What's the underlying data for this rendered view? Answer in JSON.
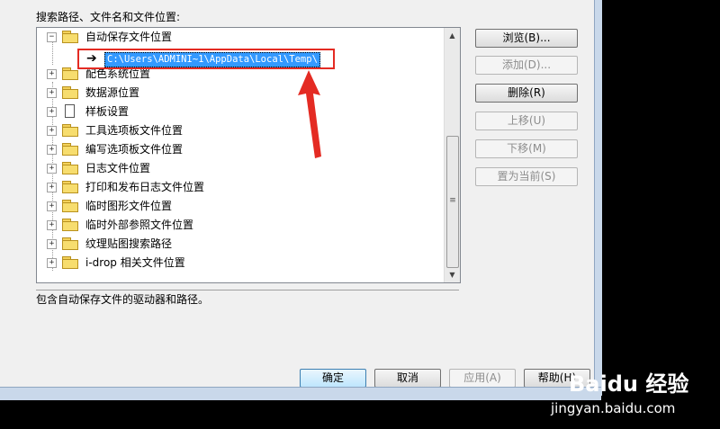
{
  "dialog": {
    "caption": "搜索路径、文件名和文件位置:",
    "tree": {
      "items": [
        {
          "label": "自动保存文件位置",
          "expander": "⊟",
          "icon": "folder-icon",
          "expanded": true
        },
        {
          "label": "配色系统位置",
          "expander": "⊞",
          "icon": "folder-icon"
        },
        {
          "label": "数据源位置",
          "expander": "⊞",
          "icon": "folder-icon"
        },
        {
          "label": "样板设置",
          "expander": "⊞",
          "icon": "document-icon"
        },
        {
          "label": "工具选项板文件位置",
          "expander": "⊞",
          "icon": "folder-icon"
        },
        {
          "label": "编写选项板文件位置",
          "expander": "⊞",
          "icon": "folder-icon"
        },
        {
          "label": "日志文件位置",
          "expander": "⊞",
          "icon": "folder-icon"
        },
        {
          "label": "打印和发布日志文件位置",
          "expander": "⊞",
          "icon": "folder-icon"
        },
        {
          "label": "临时图形文件位置",
          "expander": "⊞",
          "icon": "folder-icon"
        },
        {
          "label": "临时外部参照文件位置",
          "expander": "⊞",
          "icon": "folder-icon"
        },
        {
          "label": "纹理贴图搜索路径",
          "expander": "⊞",
          "icon": "folder-icon"
        },
        {
          "label": "i-drop 相关文件位置",
          "expander": "⊞",
          "icon": "folder-icon"
        }
      ],
      "selected_path": "C:\\Users\\ADMINI~1\\AppData\\Local\\Temp\\",
      "path_arrow": "➔"
    },
    "scrollbar": {
      "up": "▲",
      "down": "▼",
      "grip": "≡"
    },
    "description": "包含自动保存文件的驱动器和路径。",
    "side_buttons": {
      "browse": "浏览(B)...",
      "add": "添加(D)...",
      "delete": "删除(R)",
      "move_up": "上移(U)",
      "move_down": "下移(M)",
      "set_current": "置为当前(S)"
    },
    "bottom_buttons": {
      "ok": "确定",
      "cancel": "取消",
      "apply": "应用(A)",
      "help": "帮助(H)"
    }
  },
  "watermark": {
    "logo": "Baidu 经验",
    "url": "jingyan.baidu.com"
  },
  "colors": {
    "highlight": "#e42b23",
    "selection": "#3399ff"
  }
}
